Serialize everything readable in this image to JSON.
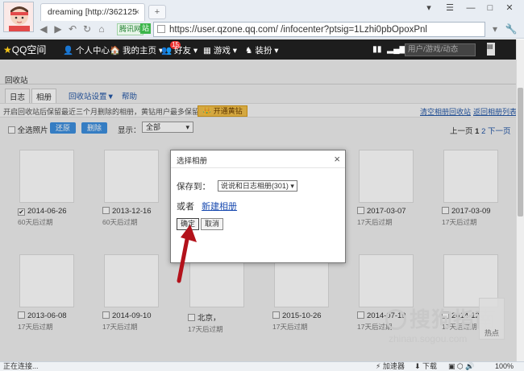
{
  "browser": {
    "tab_title": "dreaming [http://362125",
    "tab_close": "×",
    "new_tab": "+",
    "url": "https://user.qzone.qq.com/                /infocenter?ptsig=1Lzhi0pbOpoxPnl",
    "badge_txcloud": "腾讯网",
    "badge_green": "站",
    "status": "正在连接...",
    "status_accel": "加速器",
    "status_download": "下载",
    "status_zoom": "100%"
  },
  "qzone": {
    "logo": "QQ空间",
    "nav": [
      "个人中心",
      "我的主页",
      "好友",
      "游戏",
      "装扮"
    ],
    "friends_count": "15",
    "search_placeholder": "用户/游戏/动态"
  },
  "recycle": {
    "title": "回收站",
    "tabs": [
      "日志",
      "相册",
      "回收站设置▼",
      "帮助"
    ],
    "info": "开启回收站后保留最近三个月删除的相册，黄钻用户最多保留一年",
    "open_vip": "开通黄钻",
    "clear_link": "清空相册回收站",
    "back_link": "返回相册列表",
    "select_all": "全选照片",
    "restore": "还原",
    "delete": "删除",
    "show_label": "显示：",
    "show_value": "全部",
    "pager_prev": "上一页",
    "pager_1": "1",
    "pager_2": "2",
    "pager_next": "下一页"
  },
  "albums": [
    {
      "name": "2014-06-26",
      "note": "60天后过期",
      "checked": true
    },
    {
      "name": "2013-12-16",
      "note": "60天后过期",
      "checked": false
    },
    {
      "name": "2017-03-07",
      "note": "17天后过期",
      "checked": false
    },
    {
      "name": "2017-03-09",
      "note": "17天后过期",
      "checked": false
    },
    {
      "name": "2013-06-08",
      "note": "17天后过期",
      "checked": false
    },
    {
      "name": "2014-09-10",
      "note": "17天后过期",
      "checked": false
    },
    {
      "name": "北京，",
      "note": "17天后过期",
      "checked": false
    },
    {
      "name": "2015-10-26",
      "note": "17天后过期",
      "checked": false
    },
    {
      "name": "2014-07-19",
      "note": "17天后过期",
      "checked": false
    },
    {
      "name": "2014-12-",
      "note": "17天后过期",
      "checked": false
    }
  ],
  "dialog": {
    "title": "选择相册",
    "save_to_label": "保存到：",
    "save_to_value": "说说和日志相册(301) ▾",
    "or_label": "或者",
    "new_album": "新建相册",
    "confirm": "确定",
    "cancel": "取消",
    "close": "×"
  },
  "watermark": {
    "brand": "搜狗指南",
    "url": "zhinan.sogou.com",
    "hot": "热点"
  }
}
